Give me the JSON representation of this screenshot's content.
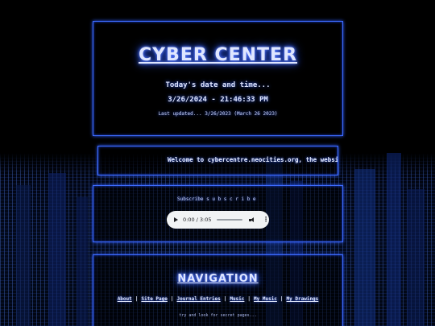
{
  "header": {
    "title": "CYBER CENTER",
    "date_heading": "Today's date and time...",
    "date_time": "3/26/2024 - 21:46:33 PM",
    "last_updated": "Last updated... 3/26/2023 (March 26 2023)"
  },
  "welcome": {
    "marquee_text": "Welcome to cybercentre.neocities.org, the website"
  },
  "music": {
    "subscribe_text": "Subscribe  s  u  b  s  c  r  i  b  e",
    "player": {
      "time": "0:00 / 3:05"
    }
  },
  "navigation": {
    "title": "NAVIGATION",
    "links": [
      "About",
      "Site Page",
      "Journal Entries",
      "Music",
      "My Music",
      "My Drawings"
    ],
    "separator": "|",
    "secret_text": "try and look for secret pages..."
  },
  "colors": {
    "accent": "#3d6cff",
    "text": "#dfe6ff",
    "background": "#000000"
  }
}
